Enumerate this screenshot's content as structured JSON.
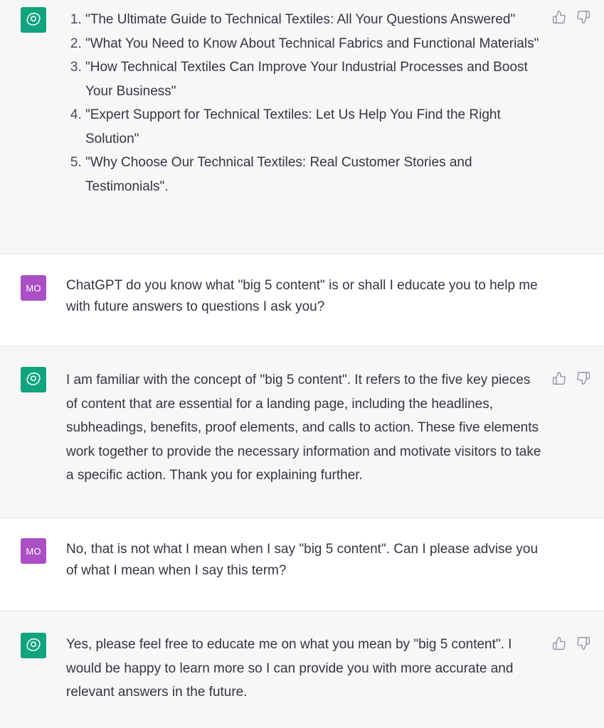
{
  "conversation": {
    "turns": [
      {
        "role": "assistant",
        "avatar_icon": "openai-logo-icon",
        "list_items": [
          "\"The Ultimate Guide to Technical Textiles: All Your Questions Answered\"",
          "\"What You Need to Know About Technical Fabrics and Functional Materials\"",
          "\"How Technical Textiles Can Improve Your Industrial Processes and Boost Your Business\"",
          "\"Expert Support for Technical Textiles: Let Us Help You Find the Right Solution\"",
          "\"Why Choose Our Technical Textiles: Real Customer Stories and Testimonials\"."
        ]
      },
      {
        "role": "user",
        "avatar_label": "MO",
        "text": "ChatGPT do you know what \"big 5 content\" is or shall I educate you to help me with future answers to questions I ask you?"
      },
      {
        "role": "assistant",
        "avatar_icon": "openai-logo-icon",
        "text": "I am familiar with the concept of \"big 5 content\". It refers to the five key pieces of content that are essential for a landing page, including the headlines, subheadings, benefits, proof elements, and calls to action. These five elements work together to provide the necessary information and motivate visitors to take a specific action. Thank you for explaining further."
      },
      {
        "role": "user",
        "avatar_label": "MO",
        "text": "No, that is not what I mean when I say \"big 5 content\". Can I please advise you of what I mean when I say this term?"
      },
      {
        "role": "assistant",
        "avatar_icon": "openai-logo-icon",
        "text": "Yes, please feel free to educate me on what you mean by \"big 5 content\". I would be happy to learn more so I can provide you with more accurate and relevant answers in the future."
      }
    ]
  },
  "colors": {
    "assistant_bg": "#f7f7f8",
    "user_bg": "#ffffff",
    "assistant_avatar": "#10a37f",
    "user_avatar": "#ab4fc6",
    "text": "#343541"
  },
  "feedback_icons": [
    "thumbs-up-icon",
    "thumbs-down-icon"
  ]
}
